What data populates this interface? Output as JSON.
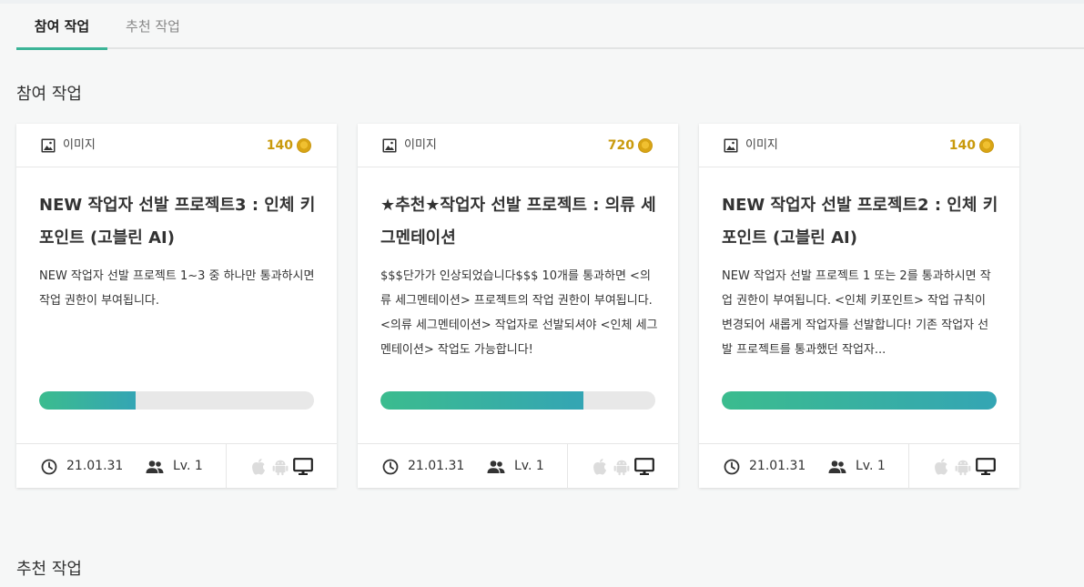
{
  "tabs": [
    {
      "label": "참여 작업",
      "active": true
    },
    {
      "label": "추천 작업",
      "active": false
    }
  ],
  "sections": {
    "participating": "참여 작업",
    "recommended": "추천 작업"
  },
  "colors": {
    "accent": "#3cb497",
    "reward": "#c99a0c",
    "progress_start": "#3bbc8e",
    "progress_end": "#34a5b4"
  },
  "cards": [
    {
      "type_icon": "image-icon",
      "type_label": "이미지",
      "reward": "140",
      "title": "NEW 작업자 선발 프로젝트3 : 인체 키포인트 (고블린 AI)",
      "description": "NEW 작업자 선발 프로젝트 1~3 중 하나만 통과하시면 작업 권한이 부여됩니다.",
      "progress": 0.35,
      "date": "21.01.31",
      "level": "Lv. 1",
      "platforms": [
        "apple-icon",
        "android-icon",
        "monitor-icon"
      ]
    },
    {
      "type_icon": "image-icon",
      "type_label": "이미지",
      "reward": "720",
      "title": "★추천★작업자 선발 프로젝트 : 의류 세그멘테이션",
      "description": "$$$단가가 인상되었습니다$$$ 10개를 통과하면 <의류 세그멘테이션> 프로젝트의 작업 권한이 부여됩니다. <의류 세그멘테이션> 작업자로 선발되셔야 <인체 세그멘테이션> 작업도 가능합니다!",
      "progress": 0.74,
      "date": "21.01.31",
      "level": "Lv. 1",
      "platforms": [
        "apple-icon",
        "android-icon",
        "monitor-icon"
      ]
    },
    {
      "type_icon": "image-icon",
      "type_label": "이미지",
      "reward": "140",
      "title": "NEW 작업자 선발 프로젝트2 : 인체 키포인트 (고블린 AI)",
      "description": "NEW 작업자 선발 프로젝트 1 또는 2를 통과하시면 작업 권한이 부여됩니다. <인체 키포인트> 작업 규칙이 변경되어 새롭게 작업자를 선발합니다! 기존 작업자 선발 프로젝트를 통과했던 작업자...",
      "progress": 1.0,
      "date": "21.01.31",
      "level": "Lv. 1",
      "platforms": [
        "apple-icon",
        "android-icon",
        "monitor-icon"
      ]
    }
  ]
}
